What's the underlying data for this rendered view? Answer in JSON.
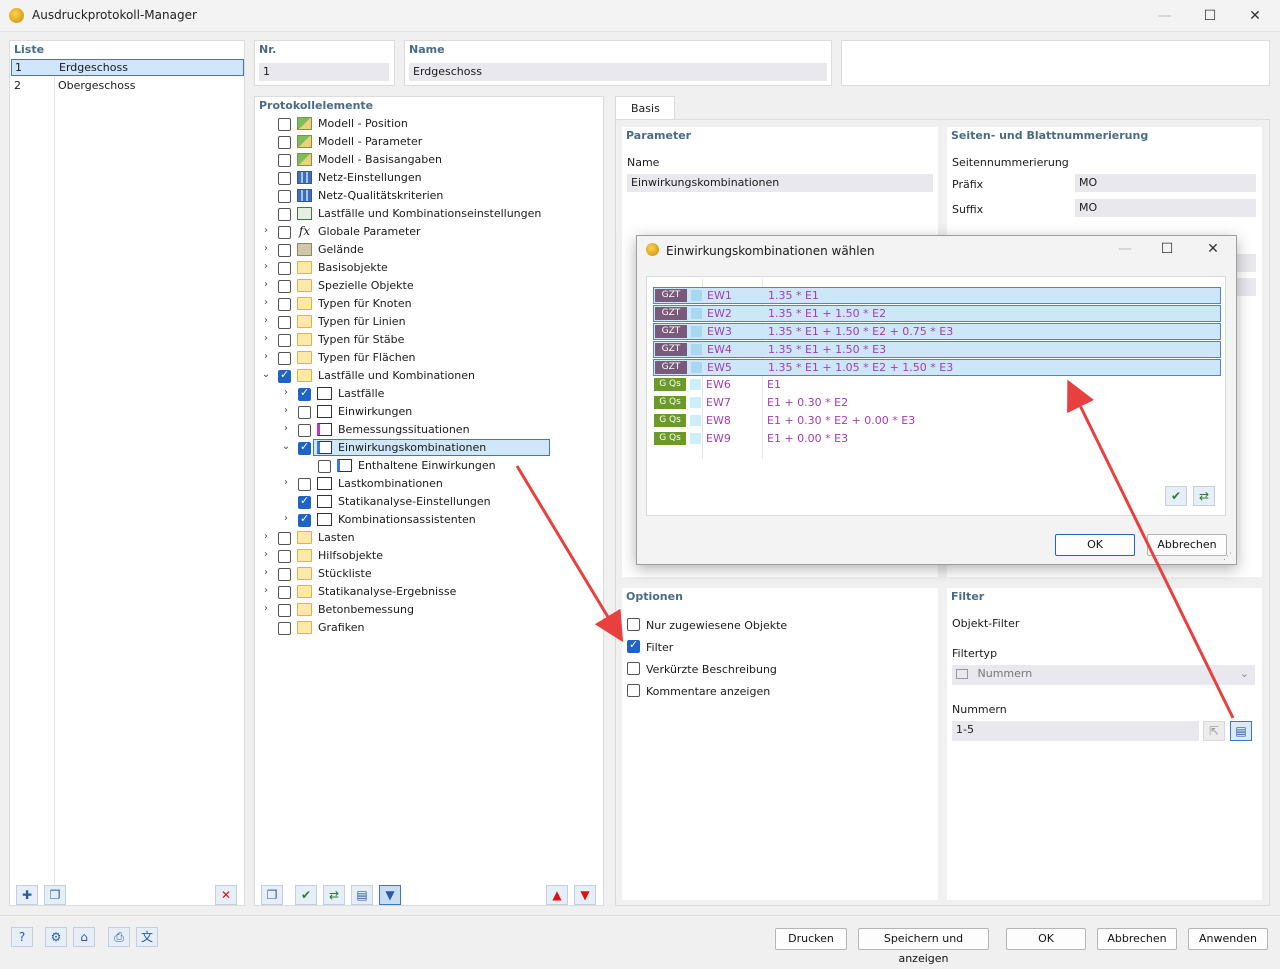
{
  "window": {
    "title": "Ausdruckprotokoll-Manager"
  },
  "liste": {
    "header": "Liste",
    "items": [
      {
        "nr": "1",
        "name": "Erdgeschoss"
      },
      {
        "nr": "2",
        "name": "Obergeschoss"
      }
    ]
  },
  "nr": {
    "label": "Nr.",
    "value": "1"
  },
  "name": {
    "label": "Name",
    "value": "Erdgeschoss"
  },
  "protokoll": {
    "header": "Protokollelemente",
    "items": [
      "Modell - Position",
      "Modell - Parameter",
      "Modell - Basisangaben",
      "Netz-Einstellungen",
      "Netz-Qualitätskriterien",
      "Lastfälle und Kombinationseinstellungen",
      "Globale Parameter",
      "Gelände",
      "Basisobjekte",
      "Spezielle Objekte",
      "Typen für Knoten",
      "Typen für Linien",
      "Typen für Stäbe",
      "Typen für Flächen",
      "Lastfälle und Kombinationen",
      "Lastfälle",
      "Einwirkungen",
      "Bemessungssituationen",
      "Einwirkungskombinationen",
      "Enthaltene Einwirkungen",
      "Lastkombinationen",
      "Statikanalyse-Einstellungen",
      "Kombinationsassistenten",
      "Lasten",
      "Hilfsobjekte",
      "Stückliste",
      "Statikanalyse-Ergebnisse",
      "Betonbemessung",
      "Grafiken"
    ]
  },
  "tabs": {
    "basis": "Basis"
  },
  "parameter": {
    "header": "Parameter",
    "name_label": "Name",
    "name_value": "Einwirkungskombinationen"
  },
  "seiten": {
    "header": "Seiten- und Blattnummerierung",
    "seitennummerierung": "Seitennummerierung",
    "praefix_label": "Präfix",
    "praefix_value": "MO",
    "suffix_label": "Suffix",
    "suffix_value": "MO"
  },
  "optionen": {
    "header": "Optionen",
    "nur": "Nur zugewiesene Objekte",
    "filter": "Filter",
    "verkuerzt": "Verkürzte Beschreibung",
    "kommentare": "Kommentare anzeigen"
  },
  "filter": {
    "header": "Filter",
    "objekt_filter": "Objekt-Filter",
    "filtertyp_label": "Filtertyp",
    "filtertyp_value": "Nummern",
    "nummern_label": "Nummern",
    "nummern_value": "1-5"
  },
  "dialog": {
    "title": "Einwirkungskombinationen wählen",
    "rows": [
      {
        "type": "GZT",
        "name": "EW1",
        "def": "1.35 * E1",
        "color": "#a9d7f0"
      },
      {
        "type": "GZT",
        "name": "EW2",
        "def": "1.35 * E1 + 1.50 * E2",
        "color": "#a9d7f0"
      },
      {
        "type": "GZT",
        "name": "EW3",
        "def": "1.35 * E1 + 1.50 * E2 + 0.75 * E3",
        "color": "#a9d7f0"
      },
      {
        "type": "GZT",
        "name": "EW4",
        "def": "1.35 * E1 + 1.50 * E3",
        "color": "#a9d7f0"
      },
      {
        "type": "GZT",
        "name": "EW5",
        "def": "1.35 * E1 + 1.05 * E2 + 1.50 * E3",
        "color": "#a9d7f0"
      },
      {
        "type": "G Qs",
        "name": "EW6",
        "def": "E1",
        "color": "#cdeffb"
      },
      {
        "type": "G Qs",
        "name": "EW7",
        "def": "E1 + 0.30 * E2",
        "color": "#cdeffb"
      },
      {
        "type": "G Qs",
        "name": "EW8",
        "def": "E1 + 0.30 * E2 + 0.00 * E3",
        "color": "#cdeffb"
      },
      {
        "type": "G Qs",
        "name": "EW9",
        "def": "E1 + 0.00 * E3",
        "color": "#cdeffb"
      }
    ],
    "ok": "OK",
    "abbrechen": "Abbrechen"
  },
  "footer": {
    "drucken": "Drucken",
    "speichern": "Speichern und anzeigen",
    "ok": "OK",
    "abbrechen": "Abbrechen",
    "anwenden": "Anwenden"
  }
}
